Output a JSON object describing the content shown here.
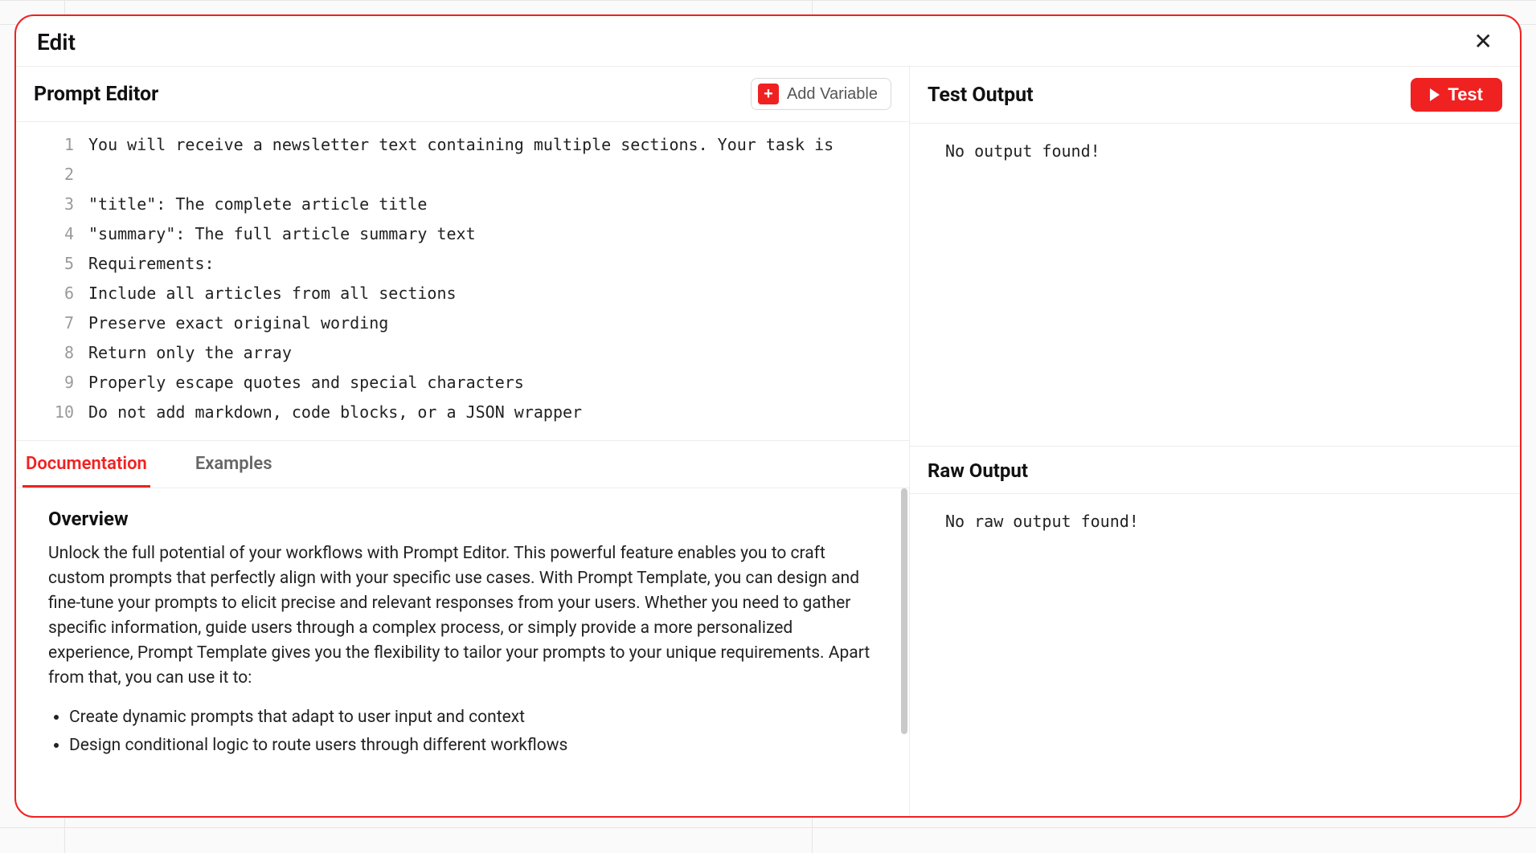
{
  "modal": {
    "title": "Edit",
    "close_label": "✕"
  },
  "prompt_editor": {
    "title": "Prompt Editor",
    "add_variable_label": "Add Variable",
    "lines": [
      "You will receive a newsletter text containing multiple sections. Your task is",
      "",
      "\"title\": The complete article title",
      "\"summary\": The full article summary text",
      "Requirements:",
      "Include all articles from all sections",
      "Preserve exact original wording",
      "Return only the array",
      "Properly escape quotes and special characters",
      "Do not add markdown, code blocks, or a JSON wrapper"
    ]
  },
  "test_output": {
    "title": "Test Output",
    "test_button_label": "Test",
    "empty_message": "No output found!"
  },
  "tabs": {
    "documentation": "Documentation",
    "examples": "Examples",
    "active": "documentation"
  },
  "documentation": {
    "heading": "Overview",
    "paragraph": "Unlock the full potential of your workflows with Prompt Editor. This powerful feature enables you to craft custom prompts that perfectly align with your specific use cases. With Prompt Template, you can design and fine-tune your prompts to elicit precise and relevant responses from your users. Whether you need to gather specific information, guide users through a complex process, or simply provide a more personalized experience, Prompt Template gives you the flexibility to tailor your prompts to your unique requirements. Apart from that, you can use it to:",
    "bullets": [
      "Create dynamic prompts that adapt to user input and context",
      "Design conditional logic to route users through different workflows"
    ]
  },
  "raw_output": {
    "title": "Raw Output",
    "empty_message": "No raw output found!"
  }
}
